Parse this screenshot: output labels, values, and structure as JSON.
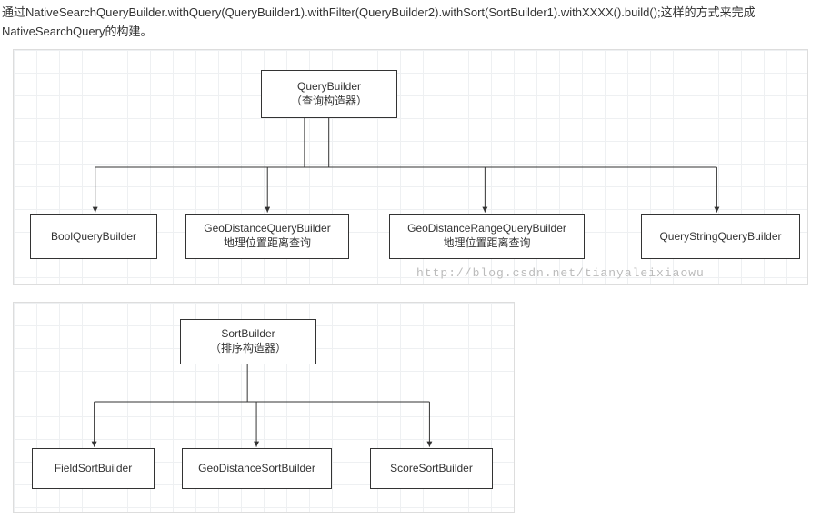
{
  "intro": {
    "line1": "通过NativeSearchQueryBuilder.withQuery(QueryBuilder1).withFilter(QueryBuilder2).withSort(SortBuilder1).withXXXX().build();这样的方式来完成",
    "line2": "NativeSearchQuery的构建。"
  },
  "diagram1": {
    "root": {
      "title": "QueryBuilder",
      "subtitle": "（查询构造器）"
    },
    "children": [
      {
        "title": "BoolQueryBuilder",
        "subtitle": ""
      },
      {
        "title": "GeoDistanceQueryBuilder",
        "subtitle": "地理位置距离查询"
      },
      {
        "title": "GeoDistanceRangeQueryBuilder",
        "subtitle": "地理位置距离查询"
      },
      {
        "title": "QueryStringQueryBuilder",
        "subtitle": ""
      }
    ],
    "watermark": "http://blog.csdn.net/tianyaleixiaowu"
  },
  "diagram2": {
    "root": {
      "title": "SortBuilder",
      "subtitle": "（排序构造器）"
    },
    "children": [
      {
        "title": "FieldSortBuilder",
        "subtitle": ""
      },
      {
        "title": "GeoDistanceSortBuilder",
        "subtitle": ""
      },
      {
        "title": "ScoreSortBuilder",
        "subtitle": ""
      }
    ]
  }
}
